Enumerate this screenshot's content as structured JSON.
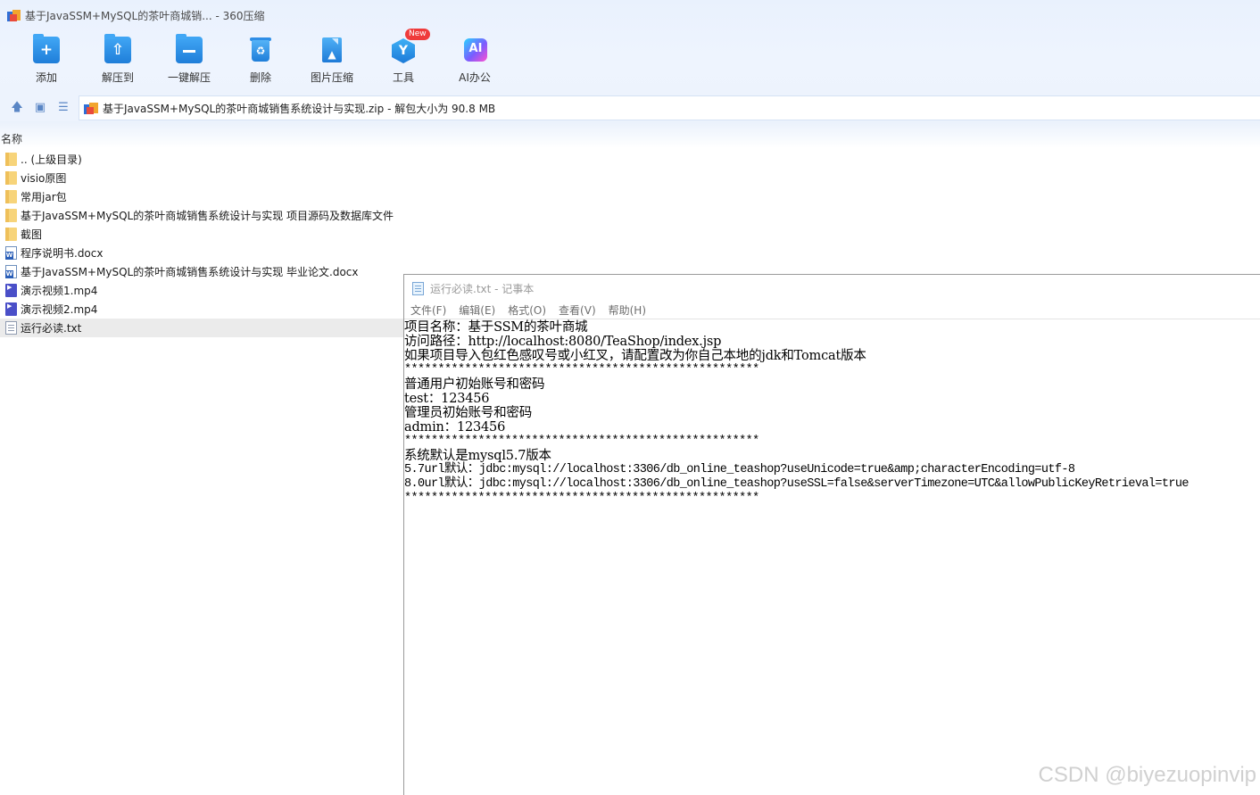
{
  "window": {
    "title": "基于JavaSSM+MySQL的茶叶商城销... - 360压缩"
  },
  "toolbar": {
    "items": [
      {
        "label": "添加",
        "icon": "add-folder-icon"
      },
      {
        "label": "解压到",
        "icon": "extract-to-icon"
      },
      {
        "label": "一键解压",
        "icon": "one-click-extract-icon"
      },
      {
        "label": "删除",
        "icon": "delete-bin-icon"
      },
      {
        "label": "图片压缩",
        "icon": "image-compress-icon"
      },
      {
        "label": "工具",
        "icon": "tools-icon",
        "badge": "New"
      },
      {
        "label": "AI办公",
        "icon": "ai-office-icon",
        "glyph": "AI"
      }
    ]
  },
  "addressbar": {
    "path": "基于JavaSSM+MySQL的茶叶商城销售系统设计与实现.zip - 解包大小为 90.8 MB"
  },
  "list": {
    "column_name": "名称",
    "items": [
      {
        "name": ".. (上级目录)",
        "type": "folder"
      },
      {
        "name": "visio原图",
        "type": "folder"
      },
      {
        "name": "常用jar包",
        "type": "folder"
      },
      {
        "name": "基于JavaSSM+MySQL的茶叶商城销售系统设计与实现 项目源码及数据库文件",
        "type": "folder"
      },
      {
        "name": "截图",
        "type": "folder"
      },
      {
        "name": "程序说明书.docx",
        "type": "docx"
      },
      {
        "name": "基于JavaSSM+MySQL的茶叶商城销售系统设计与实现 毕业论文.docx",
        "type": "docx"
      },
      {
        "name": "演示视频1.mp4",
        "type": "video"
      },
      {
        "name": "演示视频2.mp4",
        "type": "video"
      },
      {
        "name": "运行必读.txt",
        "type": "txt",
        "selected": true
      }
    ]
  },
  "notepad": {
    "title": "运行必读.txt - 记事本",
    "menus": [
      "文件(F)",
      "编辑(E)",
      "格式(O)",
      "查看(V)",
      "帮助(H)"
    ],
    "lines": [
      "项目名称：基于SSM的茶叶商城",
      "访问路径：http://localhost:8080/TeaShop/index.jsp",
      "如果项目导入包红色感叹号或小红叉，请配置改为你自己本地的jdk和Tomcat版本",
      "*****************************************************",
      "普通用户初始账号和密码",
      "test：123456",
      "管理员初始账号和密码",
      "admin：123456",
      "*****************************************************",
      "系统默认是mysql5.7版本",
      "5.7url默认：jdbc:mysql://localhost:3306/db_online_teashop?useUnicode=true&amp;characterEncoding=utf-8",
      "8.0url默认：jdbc:mysql://localhost:3306/db_online_teashop?useSSL=false&serverTimezone=UTC&allowPublicKeyRetrieval=true",
      "*****************************************************"
    ]
  },
  "watermark": "CSDN @biyezuopinvip",
  "colors": {
    "toolbar_bg": "#eef4fe",
    "accent_blue": "#1f7ed9",
    "badge_red": "#ef3b3b"
  }
}
